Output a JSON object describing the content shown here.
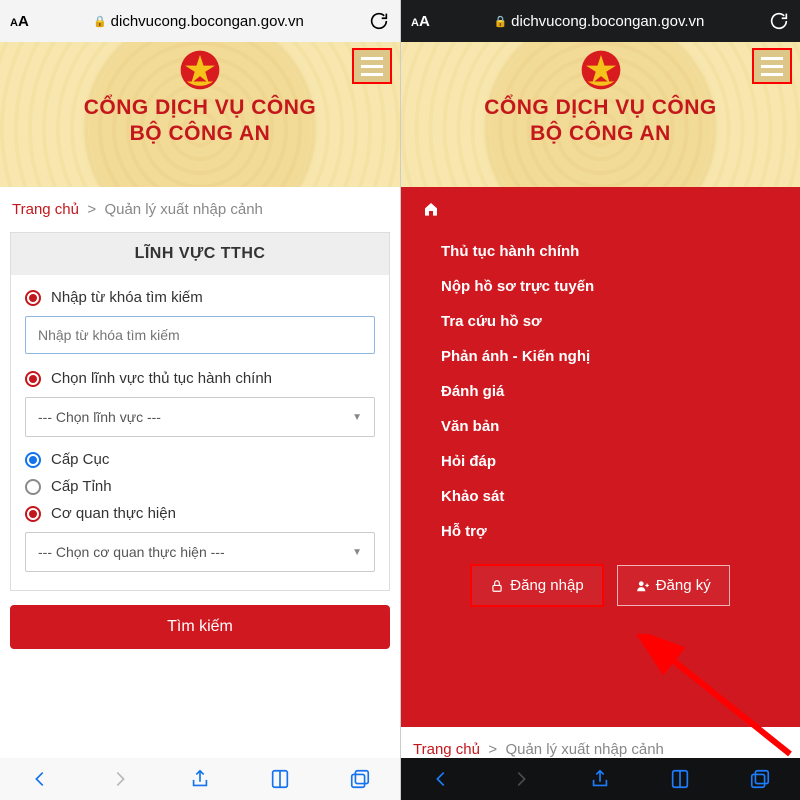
{
  "browser": {
    "aa_small": "A",
    "aa_big": "A",
    "url": "dichvucong.bocongan.gov.vn"
  },
  "banner": {
    "title1": "CỔNG DỊCH VỤ CÔNG",
    "title2": "BỘ CÔNG AN"
  },
  "breadcrumb": {
    "home": "Trang chủ",
    "sep": ">",
    "current": "Quản lý xuất nhập cảnh"
  },
  "form": {
    "heading": "LĨNH VỰC TTHC",
    "keyword_label": "Nhập từ khóa tìm kiếm",
    "keyword_placeholder": "Nhập từ khóa tìm kiếm",
    "field_label": "Chọn lĩnh vực thủ tục hành chính",
    "field_placeholder": "--- Chọn lĩnh vực ---",
    "level_cuc": "Cấp Cục",
    "level_tinh": "Cấp Tỉnh",
    "agency_label": "Cơ quan thực hiện",
    "agency_placeholder": "--- Chọn cơ quan thực hiện ---",
    "search_btn": "Tìm kiếm"
  },
  "menu": {
    "items": [
      "Thủ tục hành chính",
      "Nộp hồ sơ trực tuyến",
      "Tra cứu hồ sơ",
      "Phản ánh - Kiến nghị",
      "Đánh giá",
      "Văn bản",
      "Hỏi đáp",
      "Khảo sát",
      "Hỗ trợ"
    ],
    "login": "Đăng nhập",
    "register": "Đăng ký"
  }
}
